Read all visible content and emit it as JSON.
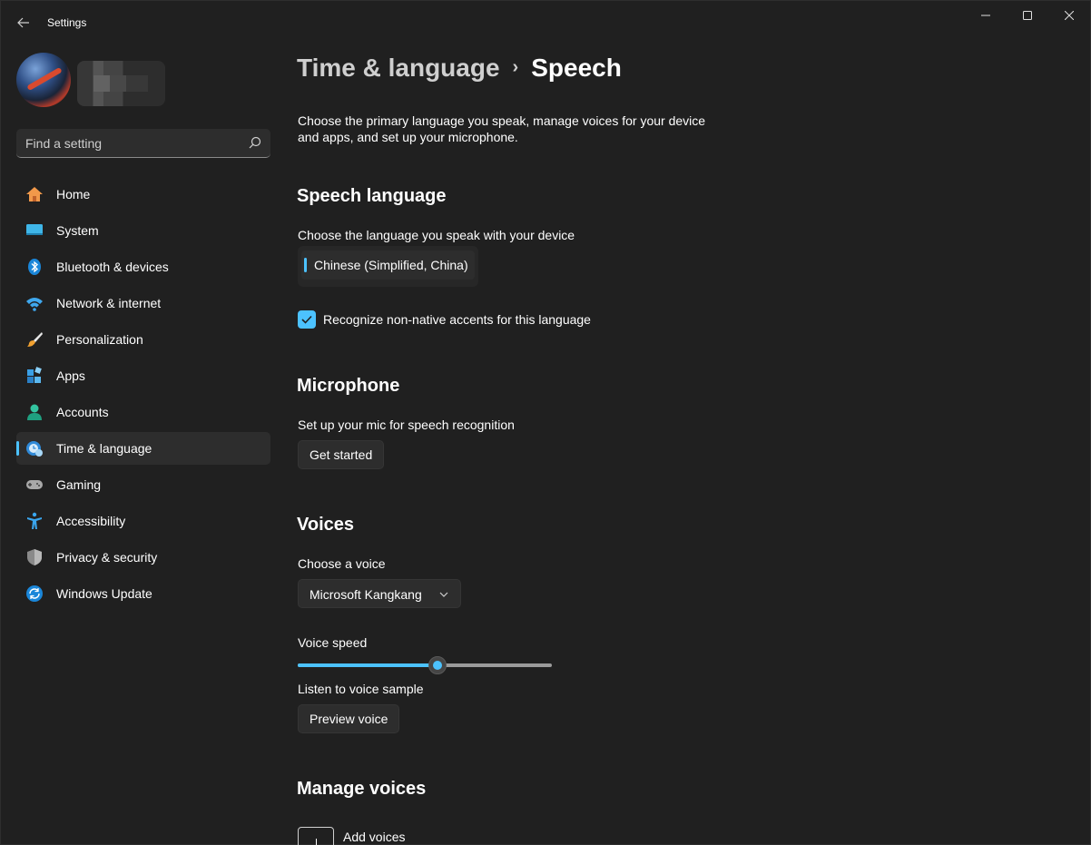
{
  "window": {
    "title": "Settings"
  },
  "search": {
    "placeholder": "Find a setting"
  },
  "sidebar": {
    "items": [
      {
        "label": "Home",
        "icon": "home-icon"
      },
      {
        "label": "System",
        "icon": "system-icon"
      },
      {
        "label": "Bluetooth & devices",
        "icon": "bluetooth-icon"
      },
      {
        "label": "Network & internet",
        "icon": "wifi-icon"
      },
      {
        "label": "Personalization",
        "icon": "brush-icon"
      },
      {
        "label": "Apps",
        "icon": "apps-icon"
      },
      {
        "label": "Accounts",
        "icon": "account-icon"
      },
      {
        "label": "Time & language",
        "icon": "time-language-icon",
        "active": true
      },
      {
        "label": "Gaming",
        "icon": "gamepad-icon"
      },
      {
        "label": "Accessibility",
        "icon": "accessibility-icon"
      },
      {
        "label": "Privacy & security",
        "icon": "shield-icon"
      },
      {
        "label": "Windows Update",
        "icon": "update-icon"
      }
    ]
  },
  "breadcrumb": {
    "parent": "Time & language",
    "separator": "›",
    "current": "Speech"
  },
  "main": {
    "description": "Choose the primary language you speak, manage voices for your device and apps, and set up your microphone.",
    "speech_language": {
      "title": "Speech language",
      "subtitle": "Choose the language you speak with your device",
      "selected_language": "Chinese (Simplified, China)",
      "accents_checkbox_label": "Recognize non-native accents for this language",
      "accents_checked": true
    },
    "microphone": {
      "title": "Microphone",
      "subtitle": "Set up your mic for speech recognition",
      "button": "Get started"
    },
    "voices": {
      "title": "Voices",
      "choose_label": "Choose a voice",
      "selected_voice": "Microsoft Kangkang",
      "speed_label": "Voice speed",
      "speed_value": 0.55,
      "sample_label": "Listen to voice sample",
      "preview_button": "Preview voice"
    },
    "manage_voices": {
      "title": "Manage voices",
      "add_label": "Add voices"
    }
  },
  "colors": {
    "accent": "#4cc2ff",
    "background": "#202020",
    "card": "#2d2d2d"
  }
}
